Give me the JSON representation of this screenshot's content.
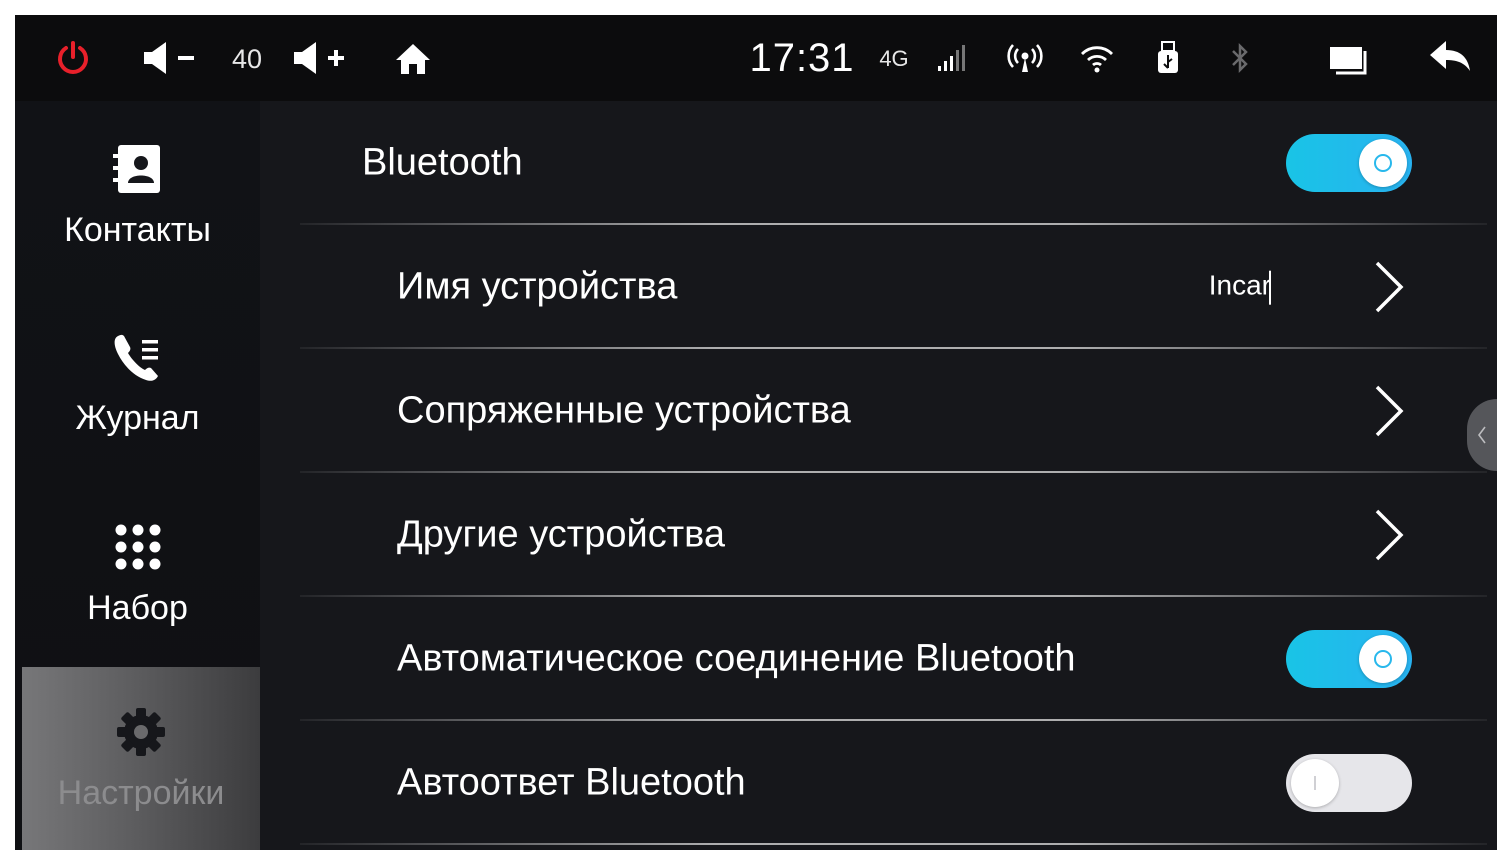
{
  "status_bar": {
    "volume": "40",
    "time": "17:31",
    "network": "4G",
    "icons": [
      "power-icon",
      "volume-down-icon",
      "volume-up-icon",
      "home-icon",
      "signal-icon",
      "hotspot-icon",
      "wifi-icon",
      "usb-icon",
      "bluetooth-icon",
      "multitask-icon",
      "back-icon"
    ],
    "colors": {
      "power": "#e8202a"
    }
  },
  "sidebar": {
    "items": [
      {
        "label": "Контакты",
        "icon": "contacts-icon"
      },
      {
        "label": "Журнал",
        "icon": "call-log-icon"
      },
      {
        "label": "Набор",
        "icon": "dialpad-icon"
      },
      {
        "label": "Настройки",
        "icon": "gear-icon",
        "selected": true
      }
    ]
  },
  "settings": {
    "bluetooth": {
      "label": "Bluetooth",
      "enabled": true
    },
    "device_name": {
      "label": "Имя устройства",
      "value": "Incar"
    },
    "paired_devices": {
      "label": "Сопряженные устройства"
    },
    "other_devices": {
      "label": "Другие устройства"
    },
    "auto_connect": {
      "label": "Автоматическое соединение Bluetooth",
      "enabled": true
    },
    "auto_answer": {
      "label": "Автоответ Bluetooth",
      "enabled": false
    }
  },
  "colors": {
    "accent": "#1fbde8",
    "background": "#16171b"
  }
}
